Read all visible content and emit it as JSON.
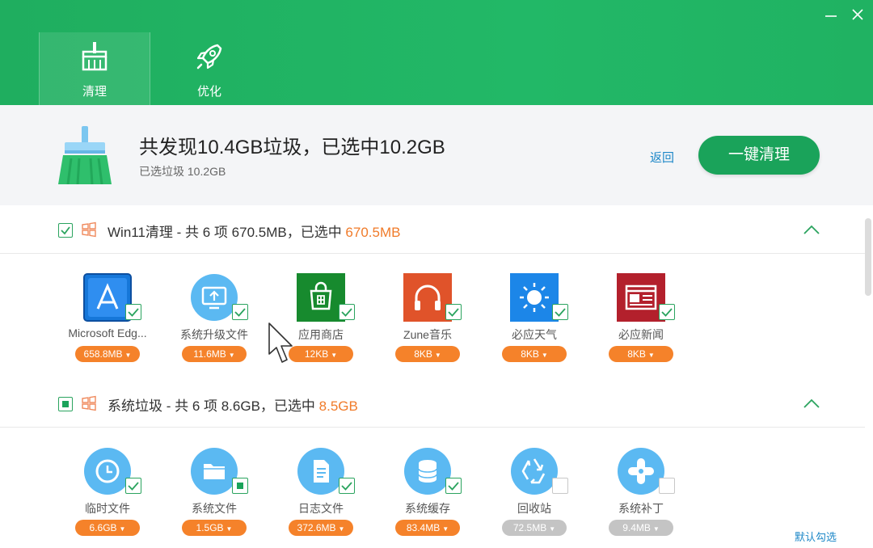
{
  "header": {
    "tabs": [
      {
        "label": "清理",
        "icon": "broom-icon",
        "active": true
      },
      {
        "label": "优化",
        "icon": "rocket-icon",
        "active": false
      }
    ],
    "window_buttons": [
      "minimize-icon",
      "close-icon"
    ]
  },
  "summary": {
    "title": "共发现10.4GB垃圾，已选中10.2GB",
    "subtitle": "已选垃圾 10.2GB",
    "back_label": "返回",
    "clean_button": "一键清理"
  },
  "sections": [
    {
      "title_prefix": "Win11清理 - 共 6 项 670.5MB，已选中 ",
      "title_highlight": "670.5MB",
      "checked": "full",
      "items": [
        {
          "name": "Microsoft Edg...",
          "size": "658.8MB",
          "icon": "app-store-icon",
          "checked": true
        },
        {
          "name": "系统升级文件",
          "size": "11.6MB",
          "icon": "system-upgrade-icon",
          "checked": true
        },
        {
          "name": "应用商店",
          "size": "12KB",
          "icon": "store-icon",
          "checked": true
        },
        {
          "name": "Zune音乐",
          "size": "8KB",
          "icon": "headphones-icon",
          "checked": true
        },
        {
          "name": "必应天气",
          "size": "8KB",
          "icon": "weather-sun-icon",
          "checked": true
        },
        {
          "name": "必应新闻",
          "size": "8KB",
          "icon": "news-icon",
          "checked": true
        }
      ]
    },
    {
      "title_prefix": "系统垃圾 - 共 6 项 8.6GB，已选中 ",
      "title_highlight": "8.5GB",
      "checked": "partial",
      "items": [
        {
          "name": "临时文件",
          "size": "6.6GB",
          "icon": "clock-icon",
          "checked": true
        },
        {
          "name": "系统文件",
          "size": "1.5GB",
          "icon": "folder-icon",
          "checked": "partial"
        },
        {
          "name": "日志文件",
          "size": "372.6MB",
          "icon": "document-icon",
          "checked": true
        },
        {
          "name": "系统缓存",
          "size": "83.4MB",
          "icon": "database-icon",
          "checked": true
        },
        {
          "name": "回收站",
          "size": "72.5MB",
          "icon": "recycle-icon",
          "checked": false
        },
        {
          "name": "系统补丁",
          "size": "9.4MB",
          "icon": "patch-icon",
          "checked": false
        }
      ]
    }
  ],
  "footer": {
    "default_select": "默认勾选"
  },
  "colors": {
    "brand_green": "#22b867",
    "accent_orange": "#f5822a",
    "link_blue": "#1e88c8"
  }
}
